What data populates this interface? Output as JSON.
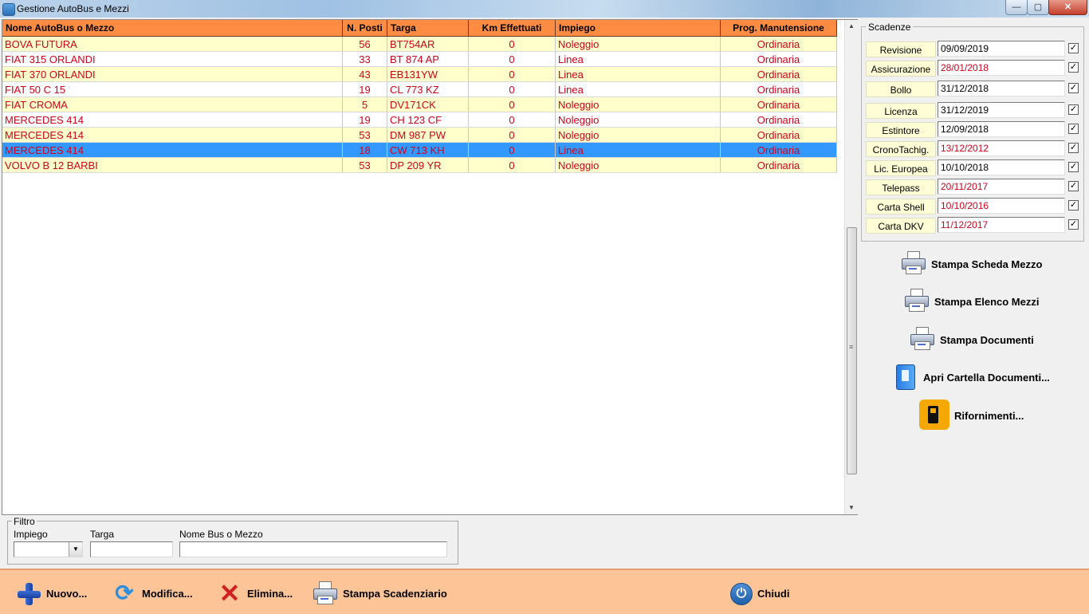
{
  "window": {
    "title": "Gestione AutoBus e Mezzi",
    "controls": {
      "minimize": "—",
      "maximize": "▢",
      "close": "✕"
    }
  },
  "grid": {
    "columns": [
      "Nome AutoBus o Mezzo",
      "N. Posti",
      "Targa",
      "Km Effettuati",
      "Impiego",
      "Prog. Manutensione"
    ],
    "rows": [
      {
        "name": "BOVA FUTURA",
        "posti": "56",
        "targa": "BT754AR",
        "km": "0",
        "impiego": "Noleggio",
        "prog": "Ordinaria"
      },
      {
        "name": "FIAT 315 ORLANDI",
        "posti": "33",
        "targa": "BT 874 AP",
        "km": "0",
        "impiego": "Linea",
        "prog": "Ordinaria"
      },
      {
        "name": "FIAT 370 ORLANDI",
        "posti": "43",
        "targa": "EB131YW",
        "km": "0",
        "impiego": "Linea",
        "prog": "Ordinaria"
      },
      {
        "name": "FIAT 50 C 15",
        "posti": "19",
        "targa": "CL 773 KZ",
        "km": "0",
        "impiego": "Linea",
        "prog": "Ordinaria"
      },
      {
        "name": "FIAT CROMA",
        "posti": "5",
        "targa": "DV171CK",
        "km": "0",
        "impiego": "Noleggio",
        "prog": "Ordinaria"
      },
      {
        "name": "MERCEDES 414",
        "posti": "19",
        "targa": "CH 123 CF",
        "km": "0",
        "impiego": "Noleggio",
        "prog": "Ordinaria"
      },
      {
        "name": "MERCEDES 414",
        "posti": "53",
        "targa": "DM 987 PW",
        "km": "0",
        "impiego": "Noleggio",
        "prog": "Ordinaria"
      },
      {
        "name": "MERCEDES 414",
        "posti": "18",
        "targa": "CW 713 KH",
        "km": "0",
        "impiego": "Linea",
        "prog": "Ordinaria",
        "selected": true
      },
      {
        "name": "VOLVO B 12 BARBI",
        "posti": "53",
        "targa": "DP 209 YR",
        "km": "0",
        "impiego": "Noleggio",
        "prog": "Ordinaria"
      }
    ]
  },
  "scadenze": {
    "title": "Scadenze",
    "items": [
      {
        "label": "Revisione",
        "value": "09/09/2019",
        "expired": false,
        "checked": true
      },
      {
        "label": "Assicurazione",
        "value": "28/01/2018",
        "expired": true,
        "checked": true
      },
      {
        "label": "Bollo",
        "value": "31/12/2018",
        "expired": false,
        "checked": true
      },
      {
        "label": "Licenza",
        "value": "31/12/2019",
        "expired": false,
        "checked": true
      },
      {
        "label": "Estintore",
        "value": "12/09/2018",
        "expired": false,
        "checked": true
      },
      {
        "label": "CronoTachig.",
        "value": "13/12/2012",
        "expired": true,
        "checked": true
      },
      {
        "label": "Lic. Europea",
        "value": "10/10/2018",
        "expired": false,
        "checked": true
      },
      {
        "label": "Telepass",
        "value": "20/11/2017",
        "expired": true,
        "checked": true
      },
      {
        "label": "Carta Shell",
        "value": "10/10/2016",
        "expired": true,
        "checked": true
      },
      {
        "label": "Carta DKV",
        "value": "11/12/2017",
        "expired": true,
        "checked": true
      }
    ]
  },
  "actions": {
    "stampa_scheda": "Stampa Scheda Mezzo",
    "stampa_elenco": "Stampa Elenco Mezzi",
    "stampa_documenti": "Stampa Documenti",
    "apri_cartella": "Apri Cartella Documenti...",
    "rifornimenti": "Rifornimenti..."
  },
  "filter": {
    "title": "Filtro",
    "impiego_label": "Impiego",
    "targa_label": "Targa",
    "nome_label": "Nome Bus o Mezzo",
    "impiego_value": "",
    "targa_value": "",
    "nome_value": ""
  },
  "toolbar": {
    "nuovo": "Nuovo...",
    "modifica": "Modifica...",
    "elimina": "Elimina...",
    "stampa_scadenziario": "Stampa Scadenziario",
    "chiudi": "Chiudi"
  },
  "colors": {
    "header": "#ff8c42",
    "row_odd": "#ffffcc",
    "row_selected": "#3399ff",
    "text_red": "#d0021b",
    "toolbar": "#fdc497"
  }
}
